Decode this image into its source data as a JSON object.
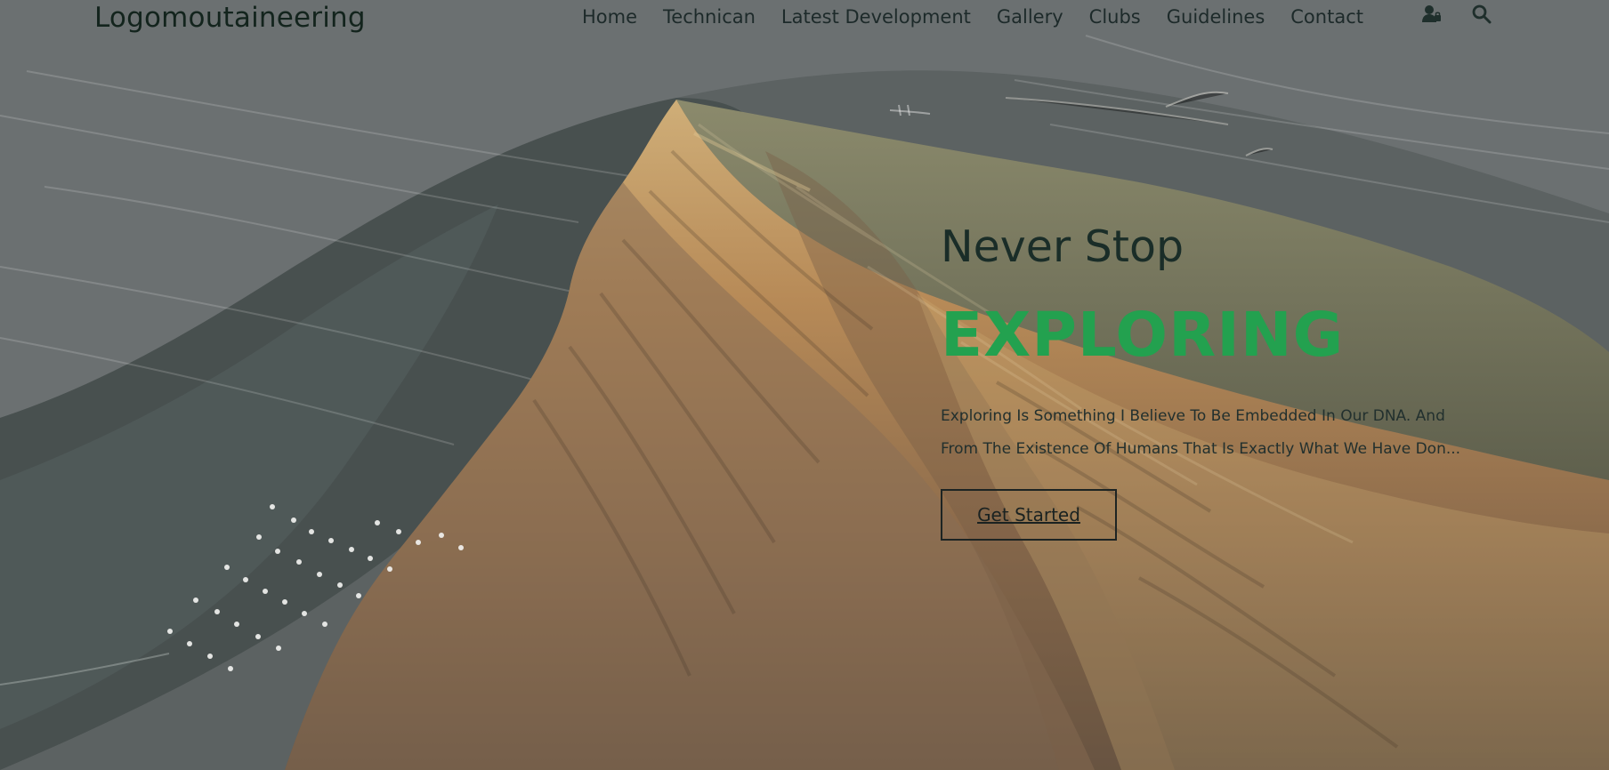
{
  "header": {
    "logo": "Logomoutaineering",
    "nav": [
      "Home",
      "Technican",
      "Latest Development",
      "Gallery",
      "Clubs",
      "Guidelines",
      "Contact"
    ],
    "icons": {
      "user": "user-lock-icon",
      "search": "search-icon"
    }
  },
  "hero": {
    "headline_small": "Never Stop",
    "headline_big": "EXPLORING",
    "intro_line_1": "Exploring Is Something I Believe To Be Embedded In Our DNA. And",
    "intro_line_2": "From The Existence Of Humans That Is Exactly What We Have Don...",
    "cta_label": "Get Started"
  },
  "colors": {
    "accent": "#23a14f",
    "text_dark": "#1a2d28",
    "cta_border": "#1d2423"
  }
}
